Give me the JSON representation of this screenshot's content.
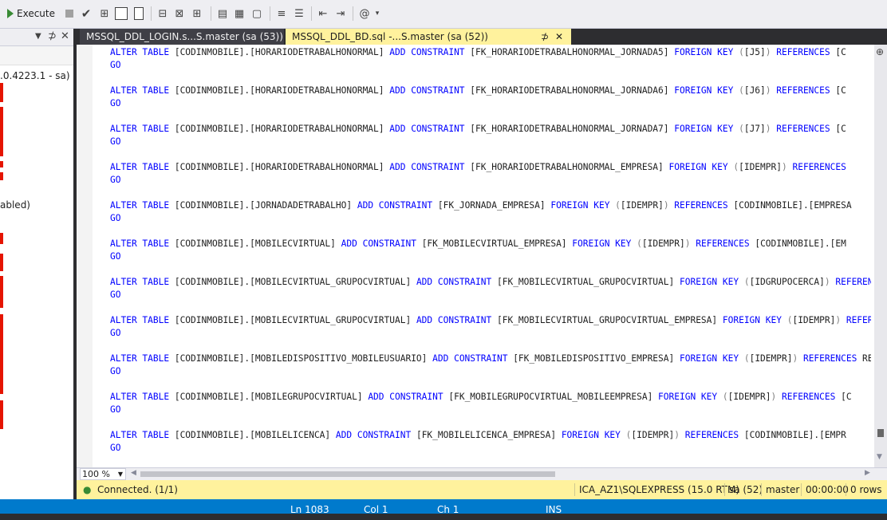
{
  "toolbar": {
    "execute_label": "Execute",
    "icons": [
      "stop-icon",
      "check-icon",
      "parse-icon",
      "display-plan-icon",
      "results-to-icon",
      "query-options-icon",
      "intellisense-icon",
      "comment-icon",
      "uncomment-icon",
      "results-grid-icon",
      "results-text-icon",
      "results-file-icon",
      "align-left-icon",
      "align-right-icon",
      "indent-icon",
      "outdent-icon",
      "specify-values-icon"
    ]
  },
  "left_panel": {
    "lines": [
      ".0.4223.1 - sa)",
      "abled)"
    ]
  },
  "tabs": [
    {
      "label": "MSSQL_DDL_LOGIN.s...S.master (sa (53))"
    },
    {
      "label": "MSSQL_DDL_BD.sql -...S.master (sa (52))",
      "pin": "⊅",
      "close": "✕"
    }
  ],
  "code": [
    {
      "table": "[HORARIODETRABALHONORMAL]",
      "constraint": "[FK_HORARIODETRABALHONORMAL_JORNADA5]",
      "fk": "[J5]",
      "tail": "[C"
    },
    {
      "table": "[HORARIODETRABALHONORMAL]",
      "constraint": "[FK_HORARIODETRABALHONORMAL_JORNADA6]",
      "fk": "[J6]",
      "tail": "[C"
    },
    {
      "table": "[HORARIODETRABALHONORMAL]",
      "constraint": "[FK_HORARIODETRABALHONORMAL_JORNADA7]",
      "fk": "[J7]",
      "tail": "[C"
    },
    {
      "table": "[HORARIODETRABALHONORMAL]",
      "constraint": "[FK_HORARIODETRABALHONORMAL_EMPRESA]",
      "fk": "[IDEMPR]",
      "tail": ""
    },
    {
      "table": "[JORNADADETRABALHO]",
      "constraint": "[FK_JORNADA_EMPRESA]",
      "fk": "[IDEMPR]",
      "tail": "[CODINMOBILE].[EMPRESA"
    },
    {
      "table": "[MOBILECVIRTUAL]",
      "constraint": "[FK_MOBILECVIRTUAL_EMPRESA]",
      "fk": "[IDEMPR]",
      "tail": "[CODINMOBILE].[EM"
    },
    {
      "table": "[MOBILECVIRTUAL_GRUPOCVIRTUAL]",
      "constraint": "[FK_MOBILECVIRTUAL_GRUPOCVIRTUAL]",
      "fk": "[IDGRUPOCERCA]",
      "tail": "RE"
    },
    {
      "table": "[MOBILECVIRTUAL_GRUPOCVIRTUAL]",
      "constraint": "[FK_MOBILECVIRTUAL_GRUPOCVIRTUAL_EMPRESA]",
      "fk": "[IDEMPR]",
      "tail": ""
    },
    {
      "table": "[MOBILEDISPOSITIVO_MOBILEUSUARIO]",
      "constraint": "[FK_MOBILEDISPOSITIVO_EMPRESA]",
      "fk": "[IDEMPR]",
      "tail": "REFERENC"
    },
    {
      "table": "[MOBILEGRUPOCVIRTUAL]",
      "constraint": "[FK_MOBILEGRUPOCVIRTUAL_MOBILEEMPRESA]",
      "fk": "[IDEMPR]",
      "tail": "[C"
    },
    {
      "table": "[MOBILELICENCA]",
      "constraint": "[FK_MOBILELICENCA_EMPRESA]",
      "fk": "[IDEMPR]",
      "tail": "[CODINMOBILE].[EMPR"
    }
  ],
  "keywords": {
    "alter": "ALTER",
    "table": "TABLE",
    "schema": "[CODINMOBILE].",
    "add": "ADD",
    "constraint": "CONSTRAINT",
    "foreign": "FOREIGN",
    "key": "KEY",
    "references": "REFERENCES",
    "go": "GO"
  },
  "zoom": "100 %",
  "status": {
    "connected": "Connected. (1/1)",
    "server": "ICA_AZ1\\SQLEXPRESS (15.0 RTM)",
    "user": "sa (52)",
    "database": "master",
    "time": "00:00:00",
    "rows": "0 rows"
  },
  "app_status": [
    "Ln 1083",
    "Col 1",
    "Ch 1",
    "INS"
  ],
  "colors": {
    "keyword": "#0000ff",
    "status_bar": "#fff29d",
    "accent": "#007acc",
    "error_marker": "#e51400"
  }
}
